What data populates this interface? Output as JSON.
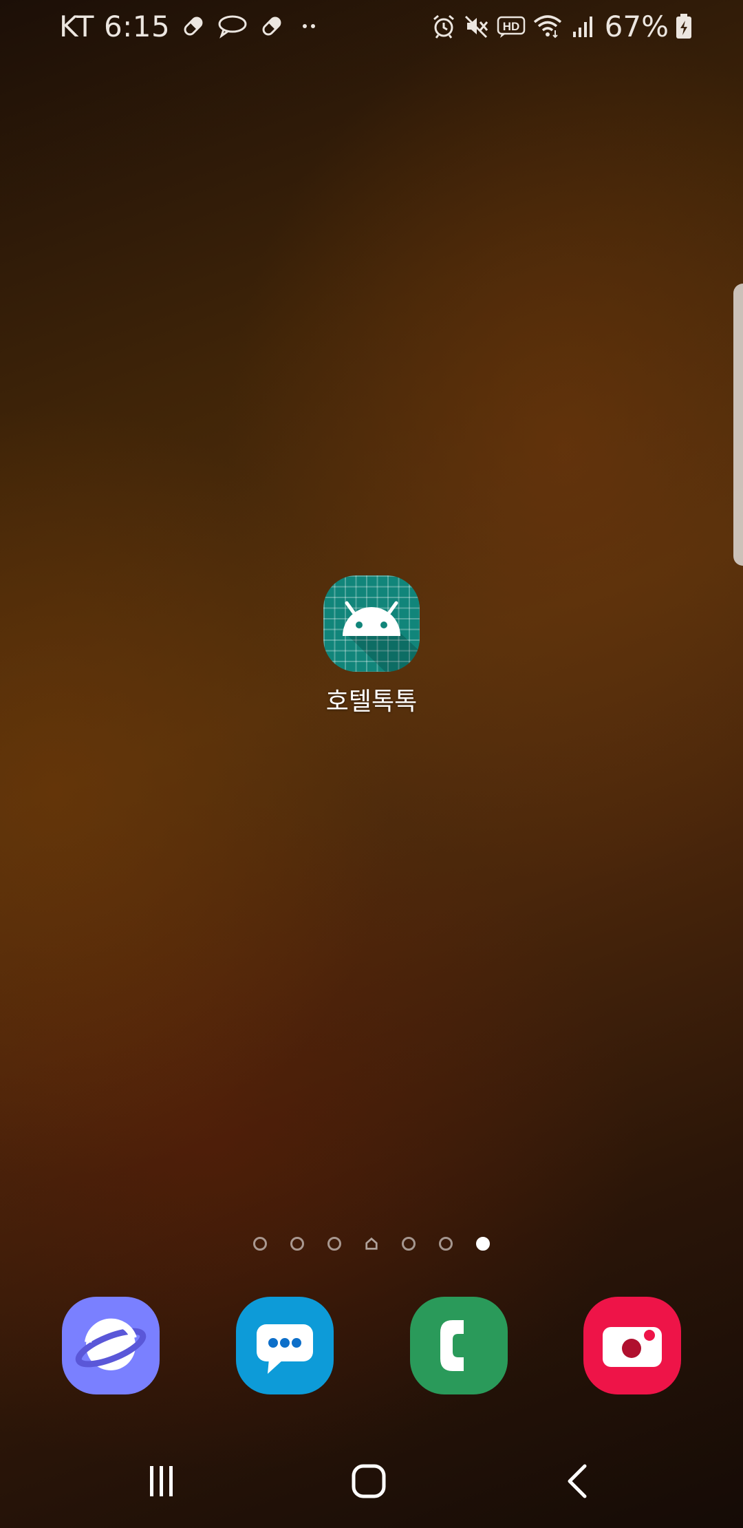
{
  "status_bar": {
    "carrier": "KT",
    "time": "6:15",
    "left_icons": [
      "pill-icon",
      "chat-bubble-icon",
      "pill-icon",
      "more-dots-icon"
    ],
    "right_icons": [
      "alarm-icon",
      "mute-icon",
      "hd-icon",
      "wifi-icon",
      "signal-icon"
    ],
    "battery_percent": "67%",
    "battery_icon": "battery-charging-icon"
  },
  "home": {
    "app": {
      "label": "호텔톡톡",
      "icon": "android-app-icon",
      "color": "#11857a"
    }
  },
  "page_indicator": {
    "pages": [
      "page",
      "page",
      "page",
      "home",
      "page",
      "page",
      "page"
    ],
    "active_index": 6
  },
  "dock": [
    {
      "name": "internet",
      "icon": "planet-icon",
      "color": "#7a80ff"
    },
    {
      "name": "messages",
      "icon": "message-bubble-icon",
      "color": "#0d9bd8"
    },
    {
      "name": "phone",
      "icon": "phone-icon",
      "color": "#2a9a5a"
    },
    {
      "name": "camera",
      "icon": "camera-icon",
      "color": "#ee1448"
    }
  ],
  "nav_bar": {
    "buttons": [
      "recent-apps-icon",
      "home-icon",
      "back-icon"
    ]
  }
}
